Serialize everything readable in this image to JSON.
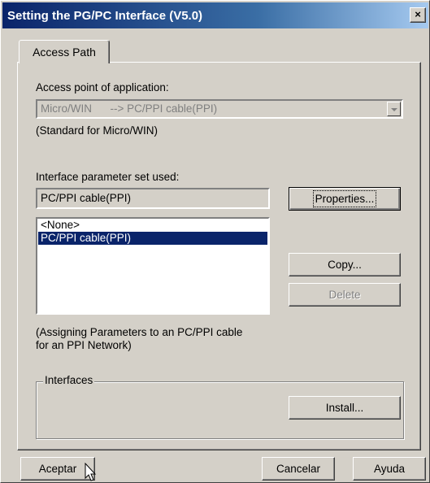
{
  "window": {
    "title": "Setting the PG/PC Interface (V5.0)",
    "close_glyph": "×"
  },
  "tabs": [
    {
      "label": "Access Path",
      "active": true
    }
  ],
  "access_point": {
    "label": "Access point of application:",
    "value": "Micro/WIN      --> PC/PPI cable(PPI)",
    "description": "(Standard for Micro/WIN)"
  },
  "interface_param": {
    "label": "Interface parameter set used:",
    "value": "PC/PPI cable(PPI)",
    "list_items": [
      {
        "label": "<None>",
        "selected": false
      },
      {
        "label": "PC/PPI cable(PPI)",
        "selected": true
      }
    ],
    "description_line1": "(Assigning Parameters to an PC/PPI cable",
    "description_line2": "for an PPI Network)"
  },
  "buttons": {
    "properties": "Properties...",
    "copy": "Copy...",
    "delete": "Delete",
    "install": "Install...",
    "ok": "Aceptar",
    "cancel": "Cancelar",
    "help": "Ayuda"
  },
  "interfaces_group": {
    "label": "Interfaces"
  },
  "colors": {
    "face": "#d4d0c8",
    "title_start": "#0a246a",
    "selection": "#0a246a",
    "disabled_text": "#808080"
  }
}
